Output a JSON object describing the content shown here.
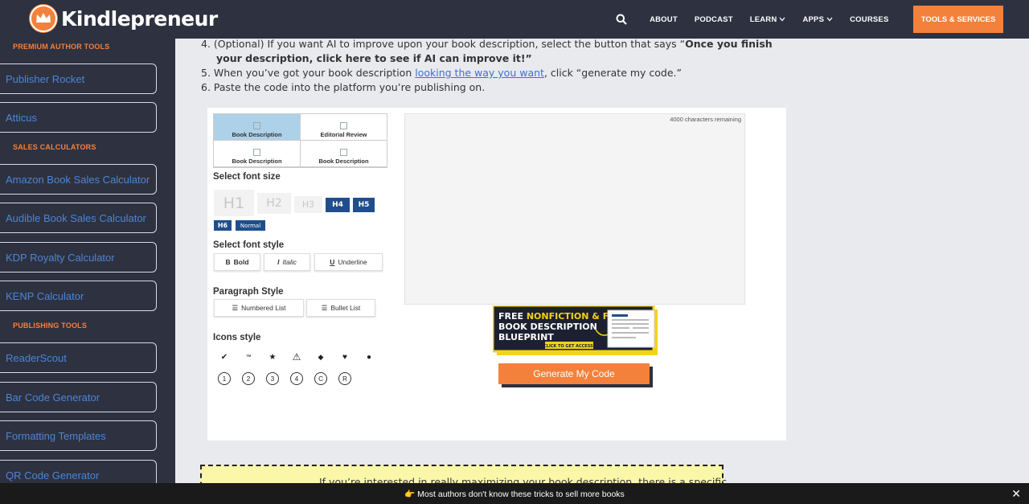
{
  "header": {
    "logo_text": "Kindlepreneur",
    "nav": {
      "search_icon": "search-icon",
      "about": "ABOUT",
      "podcast": "PODCAST",
      "learn": "LEARN",
      "apps": "APPS",
      "courses": "COURSES",
      "cta": "TOOLS & SERVICES"
    },
    "colors": {
      "bar": "#2e3140",
      "accent": "#f4813b"
    }
  },
  "sidebar": {
    "headings": [
      "PREMIUM AUTHOR TOOLS",
      "SALES CALCULATORS",
      "PUBLISHING TOOLS"
    ],
    "items": [
      "Publisher Rocket",
      "Atticus",
      "Amazon Book Sales Calculator",
      "Audible Book Sales Calculator",
      "KDP Royalty Calculator",
      "KENP Calculator",
      "ReaderScout",
      "Bar Code Generator",
      "Formatting Templates",
      "QR Code Generator"
    ]
  },
  "steps": {
    "s4_a": "4. (Optional) If you want AI to improve upon your book description, select the button that says “",
    "s4_b": "Once you finish",
    "s4_c": "your description, click here to see if AI can improve it!”",
    "s5_a": "5. When you’ve got your book description ",
    "s5_link": "looking the way you want",
    "s5_b": ", click “generate my code.”",
    "s6": "6. Paste the code into the platform you’re publishing on."
  },
  "editor": {
    "tabs": [
      "Book Description",
      "Editorial Review",
      "Book Description",
      "Book Description"
    ],
    "font_size_label": "Select font size",
    "font_sizes": [
      "H1",
      "H2",
      "H3",
      "H4",
      "H5",
      "H6",
      "Normal"
    ],
    "font_style_label": "Select font style",
    "styles": {
      "bold": "Bold",
      "italic": "Italic",
      "underline": "Underline"
    },
    "paragraph_label": "Paragraph Style",
    "paragraph": {
      "numbered": "Numbered List",
      "bullet": "Bullet List"
    },
    "icons_label": "Icons style",
    "icons_row1": [
      "✔",
      "™",
      "★",
      "⚠",
      "◆",
      "♥",
      "●"
    ],
    "icons_row2": [
      "1",
      "2",
      "3",
      "4",
      "C",
      "R"
    ],
    "remaining": "4000 characters remaining",
    "banner": {
      "line1a": "FREE ",
      "line1b": "NONFICTION & FICTION",
      "line2": "BOOK DESCRIPTION",
      "line3": "BLUEPRINT",
      "cta": "CLICK TO GET ACCESS!"
    },
    "generate": "Generate My Code"
  },
  "promo": {
    "text": "If you’re interested in really maximizing your book description, there is a specific"
  },
  "bottom_bar": {
    "emoji": "👉",
    "message": " Most authors don't know these tricks to sell more books",
    "close": "✕"
  }
}
